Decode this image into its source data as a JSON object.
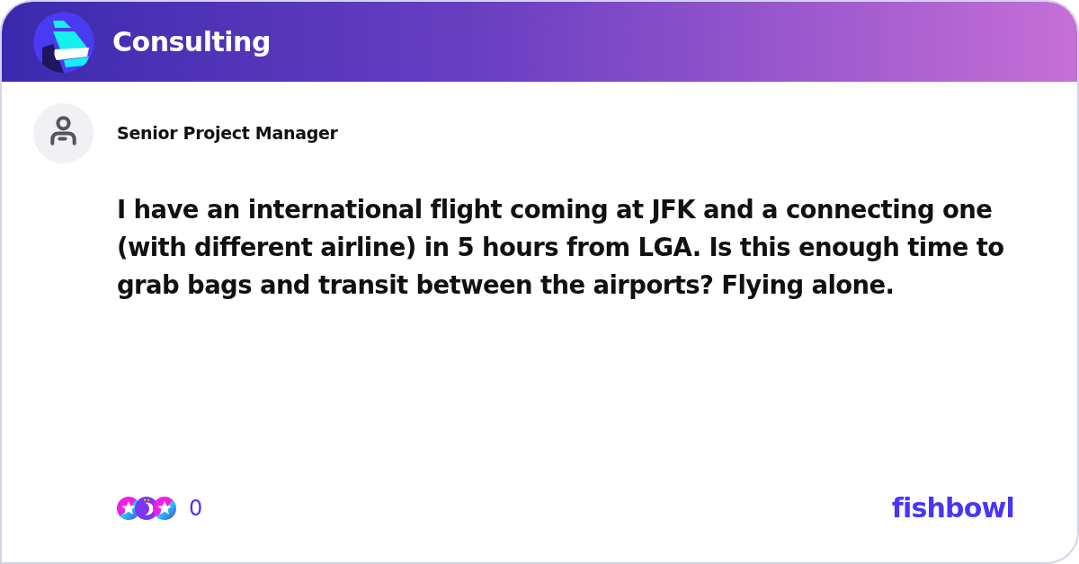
{
  "header": {
    "title": "Consulting"
  },
  "post": {
    "author": "Senior Project Manager",
    "text": "I have an international flight coming at JFK and a connecting one (with different airline) in 5 hours from LGA. Is this enough time to grab bags and transit between the airports? Flying alone."
  },
  "reactions": {
    "count": "0"
  },
  "brand": {
    "logo_text": "fishbowl"
  }
}
